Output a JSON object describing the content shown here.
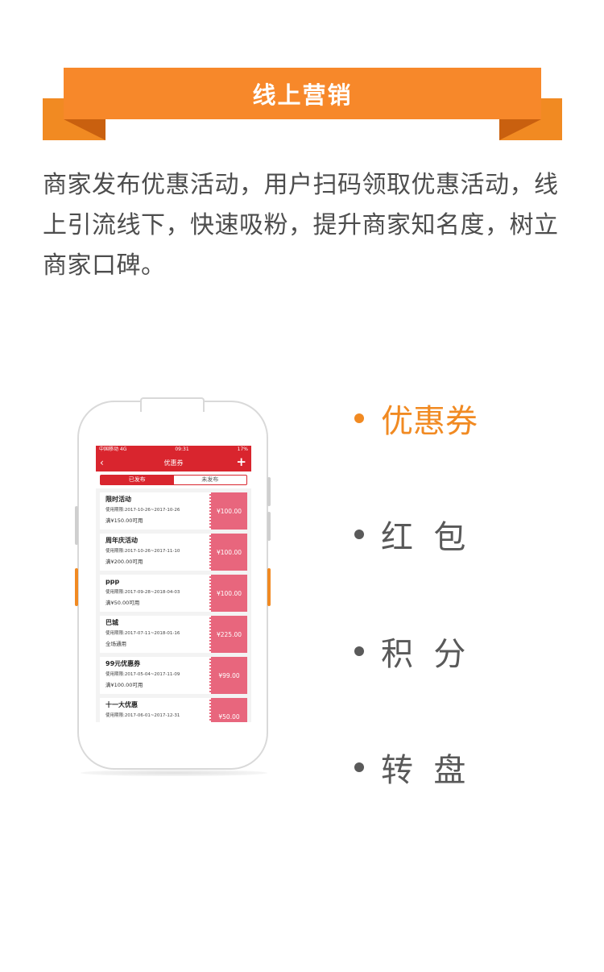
{
  "banner": {
    "title": "线上营销"
  },
  "description": "商家发布优惠活动，用户扫码领取优惠活动，线上引流线下，快速吸粉，提升商家知名度，树立商家口碑。",
  "phone": {
    "status": {
      "carrier": "中国移动  4G",
      "time": "09:31",
      "battery": "17%"
    },
    "nav": {
      "back": "‹",
      "title": "优惠券",
      "add": "+"
    },
    "tabs": [
      "已发布",
      "未发布"
    ],
    "coupons": [
      {
        "name": "限时活动",
        "period": "使用期限:2017-10-26~2017-10-26",
        "condition": "满¥150.00可用",
        "value": "¥100.00"
      },
      {
        "name": "周年庆活动",
        "period": "使用期限:2017-10-26~2017-11-10",
        "condition": "满¥200.00可用",
        "value": "¥100.00"
      },
      {
        "name": "ppp",
        "period": "使用期限:2017-09-28~2018-04-03",
        "condition": "满¥50.00可用",
        "value": "¥100.00"
      },
      {
        "name": "巴城",
        "period": "使用期限:2017-07-11~2018-01-16",
        "condition": "全场通用",
        "value": "¥225.00"
      },
      {
        "name": "99元优惠券",
        "period": "使用期限:2017-05-04~2017-11-09",
        "condition": "满¥100.00可用",
        "value": "¥99.00"
      },
      {
        "name": "十一大优惠",
        "period": "使用期限:2017-06-01~2017-12-31",
        "condition": "",
        "value": "¥50.00"
      }
    ]
  },
  "features": [
    {
      "label": "优惠券",
      "active": true
    },
    {
      "label": "红  包",
      "active": false
    },
    {
      "label": "积  分",
      "active": false
    },
    {
      "label": "转  盘",
      "active": false
    }
  ],
  "colors": {
    "accent": "#f18a22",
    "app_red": "#d9252e",
    "coupon_pink": "#e8667d",
    "text": "#4d4d4d"
  }
}
